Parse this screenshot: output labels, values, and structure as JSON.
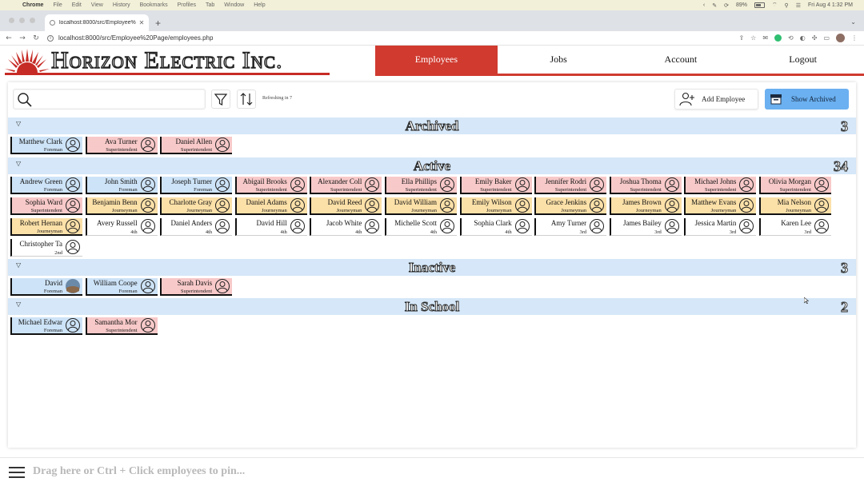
{
  "os_menubar": {
    "items": [
      "Chrome",
      "File",
      "Edit",
      "View",
      "History",
      "Bookmarks",
      "Profiles",
      "Tab",
      "Window",
      "Help"
    ],
    "battery": "89%",
    "clock": "Fri Aug 4  1:32 PM"
  },
  "browser": {
    "tab_title": "localhost:8000/src/Employee%",
    "url": "localhost:8000/src/Employee%20Page/employees.php"
  },
  "brand": {
    "name": "Horizon Electric Inc.",
    "accent": "#d03a2f"
  },
  "nav": {
    "items": [
      {
        "label": "Employees",
        "active": true
      },
      {
        "label": "Jobs",
        "active": false
      },
      {
        "label": "Account",
        "active": false
      },
      {
        "label": "Logout",
        "active": false
      }
    ]
  },
  "toolbar": {
    "search_placeholder": "",
    "refresh_text": "Refreshing in 7",
    "add_employee_label": "Add Employee",
    "show_archived_label": "Show Archived"
  },
  "colors": {
    "foreman": "#cde3f7",
    "superintendent": "#f8c9c9",
    "journeyman": "#fbe0a8",
    "apprentice": "#ffffff",
    "section_header": "#d5e7f8"
  },
  "sections": [
    {
      "title": "Archived",
      "count": "3",
      "employees": [
        {
          "name": "Matthew Clark",
          "role": "Foreman",
          "type": "foreman"
        },
        {
          "name": "Ava Turner",
          "role": "Superintendent",
          "type": "superintendent"
        },
        {
          "name": "Daniel Allen",
          "role": "Superintendent",
          "type": "superintendent"
        }
      ]
    },
    {
      "title": "Active",
      "count": "34",
      "employees": [
        {
          "name": "Andrew Green",
          "role": "Foreman",
          "type": "foreman"
        },
        {
          "name": "John Smith",
          "role": "Foreman",
          "type": "foreman"
        },
        {
          "name": "Joseph Turner",
          "role": "Foreman",
          "type": "foreman"
        },
        {
          "name": "Abigail Brooks",
          "role": "Superintendent",
          "type": "superintendent"
        },
        {
          "name": "Alexander Coll",
          "role": "Superintendent",
          "type": "superintendent"
        },
        {
          "name": "Ella Phillips",
          "role": "Superintendent",
          "type": "superintendent"
        },
        {
          "name": "Emily Baker",
          "role": "Superintendent",
          "type": "superintendent"
        },
        {
          "name": "Jennifer Rodri",
          "role": "Superintendent",
          "type": "superintendent"
        },
        {
          "name": "Joshua Thoma",
          "role": "Superintendent",
          "type": "superintendent"
        },
        {
          "name": "Michael Johns",
          "role": "Superintendent",
          "type": "superintendent"
        },
        {
          "name": "Olivia Morgan",
          "role": "Superintendent",
          "type": "superintendent"
        },
        {
          "name": "Sophia Ward",
          "role": "Superintendent",
          "type": "superintendent"
        },
        {
          "name": "Benjamin Benn",
          "role": "Journeyman",
          "type": "journeyman"
        },
        {
          "name": "Charlotte Gray",
          "role": "Journeyman",
          "type": "journeyman"
        },
        {
          "name": "Daniel Adams",
          "role": "Journeyman",
          "type": "journeyman"
        },
        {
          "name": "David Reed",
          "role": "Journeyman",
          "type": "journeyman"
        },
        {
          "name": "David William",
          "role": "Journeyman",
          "type": "journeyman"
        },
        {
          "name": "Emily Wilson",
          "role": "Journeyman",
          "type": "journeyman"
        },
        {
          "name": "Grace Jenkins",
          "role": "Journeyman",
          "type": "journeyman"
        },
        {
          "name": "James Brown",
          "role": "Journeyman",
          "type": "journeyman"
        },
        {
          "name": "Matthew Evans",
          "role": "Journeyman",
          "type": "journeyman"
        },
        {
          "name": "Mia Nelson",
          "role": "Journeyman",
          "type": "journeyman"
        },
        {
          "name": "Robert Hernan",
          "role": "Journeyman",
          "type": "journeyman"
        },
        {
          "name": "Avery Russell",
          "role": "4th",
          "type": "apprentice"
        },
        {
          "name": "Daniel Anders",
          "role": "4th",
          "type": "apprentice"
        },
        {
          "name": "David Hill",
          "role": "4th",
          "type": "apprentice"
        },
        {
          "name": "Jacob White",
          "role": "4th",
          "type": "apprentice"
        },
        {
          "name": "Michelle Scott",
          "role": "4th",
          "type": "apprentice"
        },
        {
          "name": "Sophia Clark",
          "role": "4th",
          "type": "apprentice"
        },
        {
          "name": "Amy Turner",
          "role": "3rd",
          "type": "apprentice"
        },
        {
          "name": "James Bailey",
          "role": "3rd",
          "type": "apprentice"
        },
        {
          "name": "Jessica Martin",
          "role": "3rd",
          "type": "apprentice"
        },
        {
          "name": "Karen Lee",
          "role": "3rd",
          "type": "apprentice"
        },
        {
          "name": "Christopher Ta",
          "role": "2nd",
          "type": "apprentice"
        }
      ]
    },
    {
      "title": "Inactive",
      "count": "3",
      "employees": [
        {
          "name": "David",
          "role": "Foreman",
          "type": "foreman",
          "photo": true
        },
        {
          "name": "William Coope",
          "role": "Foreman",
          "type": "foreman"
        },
        {
          "name": "Sarah Davis",
          "role": "Superintendent",
          "type": "superintendent"
        }
      ]
    },
    {
      "title": "In School",
      "count": "2",
      "employees": [
        {
          "name": "Michael Edwar",
          "role": "Foreman",
          "type": "foreman"
        },
        {
          "name": "Samantha Mor",
          "role": "Superintendent",
          "type": "superintendent"
        }
      ]
    }
  ],
  "pinbar": {
    "hint": "Drag here or Ctrl + Click employees to pin..."
  }
}
